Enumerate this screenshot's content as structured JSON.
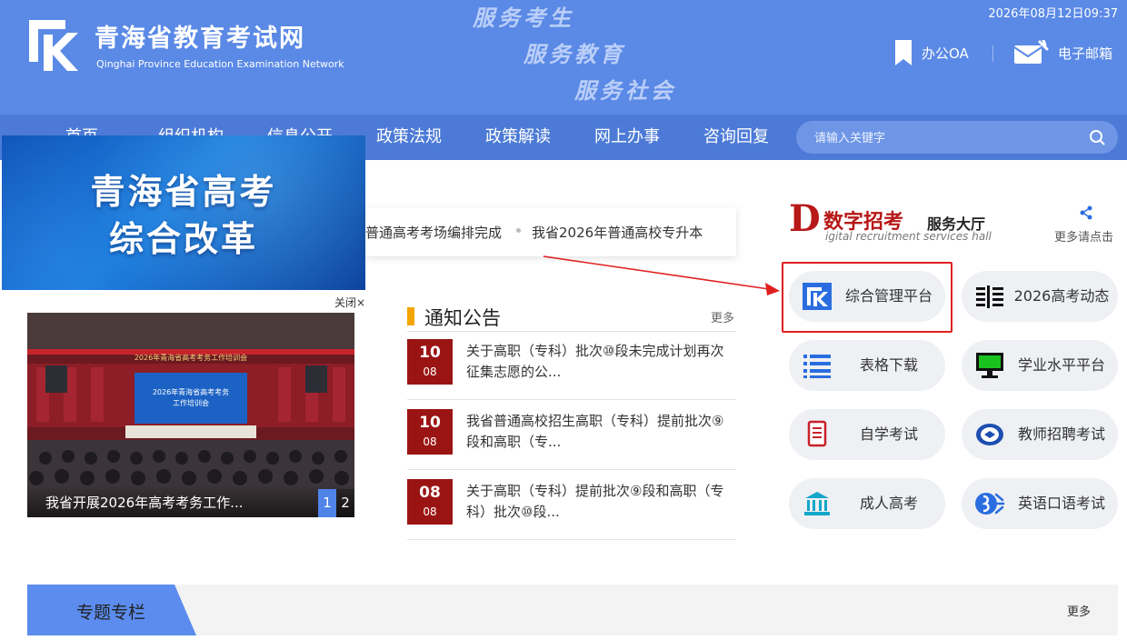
{
  "header": {
    "title": "青海省教育考试网",
    "subtitle": "Qinghai Province Education Examination Network",
    "slogans": [
      "服务考生",
      "服务教育",
      "服务社会"
    ],
    "datetime": "2026年08月12日09:37",
    "office_link": "办公OA",
    "mail_link": "电子邮箱",
    "logo_icon": "qhks-logo-icon",
    "bookmark_icon": "bookmark-icon",
    "mail_icon": "mail-icon"
  },
  "nav": {
    "items": [
      "首页",
      "组织机构",
      "信息公开",
      "政策法规",
      "政策解读",
      "网上办事",
      "咨询回复"
    ],
    "search_placeholder": "请输入关键字",
    "search_icon": "search-icon"
  },
  "banner": {
    "line1": "青海省高考",
    "line2": "综合改革",
    "close": "关闭×"
  },
  "ticker": {
    "items": [
      "普通高考考场编排完成",
      "我省2026年普通高校专升本"
    ]
  },
  "slideshow": {
    "caption": "我省开展2026年高考考务工作...",
    "pages": [
      "1",
      "2"
    ],
    "active_page": 1,
    "screen_text_1": "2026年青海省高考考务",
    "screen_text_2": "工作培训会",
    "banner_text": "2026年青海省高考考务工作培训会"
  },
  "notices": {
    "title": "通知公告",
    "more": "更多",
    "items": [
      {
        "day": "10",
        "month": "08",
        "text": "关于高职（专科）批次⑩段未完成计划再次征集志愿的公..."
      },
      {
        "day": "10",
        "month": "08",
        "text": "我省普通高校招生高职（专科）提前批次⑨段和高职（专..."
      },
      {
        "day": "08",
        "month": "08",
        "text": "关于高职（专科）提前批次⑨段和高职（专科）批次⑩段..."
      }
    ]
  },
  "digital": {
    "letter": "D",
    "title": "数字招考",
    "hall": "服务大厅",
    "subtitle": "igital recruitment services hall",
    "more": "更多请点击",
    "share_icon": "share-icon"
  },
  "services": [
    {
      "label": "综合管理平台",
      "icon": "management-platform-icon"
    },
    {
      "label": "2026高考动态",
      "icon": "news-list-icon"
    },
    {
      "label": "表格下载",
      "icon": "table-list-icon"
    },
    {
      "label": "学业水平平台",
      "icon": "monitor-icon"
    },
    {
      "label": "自学考试",
      "icon": "document-icon"
    },
    {
      "label": "教师招聘考试",
      "icon": "teacher-badge-icon"
    },
    {
      "label": "成人高考",
      "icon": "building-icon"
    },
    {
      "label": "英语口语考试",
      "icon": "speech-icon"
    }
  ],
  "topics": {
    "title": "专题专栏",
    "more": "更多"
  },
  "colors": {
    "header_bg": "#5a89e6",
    "nav_bg": "#4c7ad6",
    "date_box": "#9b1414",
    "accent_red": "#e02020",
    "notice_marker": "#f4a400"
  }
}
